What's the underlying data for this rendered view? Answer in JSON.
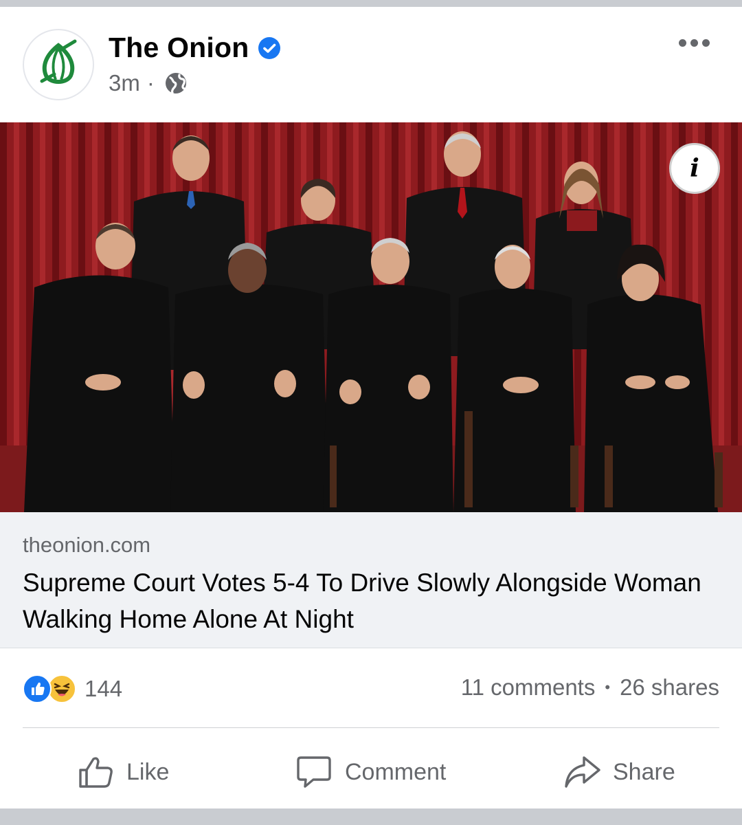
{
  "post": {
    "page_name": "The Onion",
    "time": "3m",
    "separator": "·",
    "verified_icon": "verified-badge-icon",
    "privacy_icon": "globe-icon",
    "more_icon": "more-horizontal-icon"
  },
  "link_preview": {
    "domain": "theonion.com",
    "headline": "Supreme Court Votes 5-4 To Drive Slowly Alongside Woman Walking Home Alone At Night",
    "info_label": "i"
  },
  "engagement": {
    "reaction_count": "144",
    "reaction_icons": [
      "like-reaction-icon",
      "haha-reaction-icon"
    ],
    "comments": "11 comments",
    "dot": "•",
    "shares": "26 shares"
  },
  "actions": {
    "like": "Like",
    "comment": "Comment",
    "share": "Share"
  },
  "colors": {
    "accent_blue": "#1877f2",
    "onion_green": "#1f8a3c",
    "curtain_red": "#8e1b1f",
    "text_secondary": "#65676b"
  }
}
